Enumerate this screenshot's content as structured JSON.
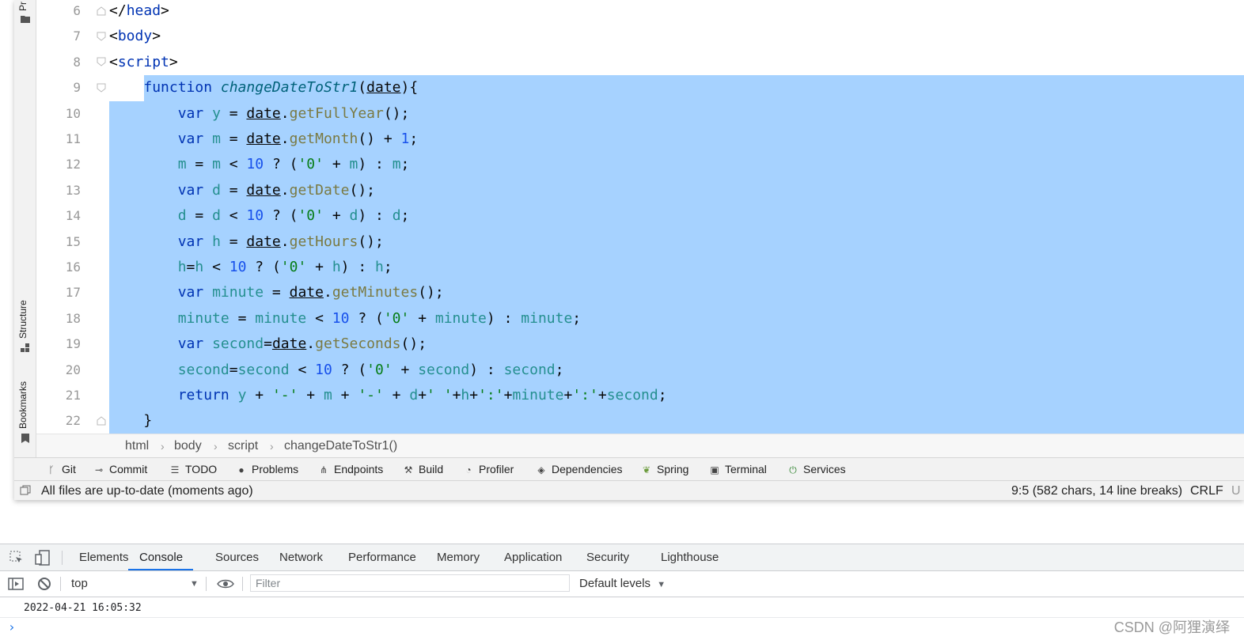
{
  "ide": {
    "side_tabs": {
      "top": "Pr",
      "structure": "Structure",
      "bookmarks": "Bookmarks"
    },
    "lines": [
      {
        "n": "6"
      },
      {
        "n": "7"
      },
      {
        "n": "8"
      },
      {
        "n": "9"
      },
      {
        "n": "10"
      },
      {
        "n": "11"
      },
      {
        "n": "12"
      },
      {
        "n": "13"
      },
      {
        "n": "14"
      },
      {
        "n": "15"
      },
      {
        "n": "16"
      },
      {
        "n": "17"
      },
      {
        "n": "18"
      },
      {
        "n": "19"
      },
      {
        "n": "20"
      },
      {
        "n": "21"
      },
      {
        "n": "22"
      }
    ],
    "breadcrumb": [
      "html",
      "body",
      "script",
      "changeDateToStr1()"
    ],
    "tool_windows": [
      "Git",
      "Commit",
      "TODO",
      "Problems",
      "Endpoints",
      "Build",
      "Profiler",
      "Dependencies",
      "Spring",
      "Terminal",
      "Services"
    ],
    "status": {
      "message": "All files are up-to-date (moments ago)",
      "position": "9:5 (582 chars, 14 line breaks)",
      "line_sep": "CRLF",
      "encoding": "U"
    }
  },
  "devtools": {
    "tabs": [
      "Elements",
      "Console",
      "Sources",
      "Network",
      "Performance",
      "Memory",
      "Application",
      "Security",
      "Lighthouse"
    ],
    "active_tab": "Console",
    "context": "top",
    "filter_placeholder": "Filter",
    "levels": "Default levels",
    "log_output": "2022-04-21 16:05:32",
    "prompt": "›"
  },
  "watermark": "CSDN @阿狸演绎",
  "colors": {
    "selection": "#a6d2ff",
    "keyword": "#0033b3",
    "accent": "#1a73e8"
  }
}
